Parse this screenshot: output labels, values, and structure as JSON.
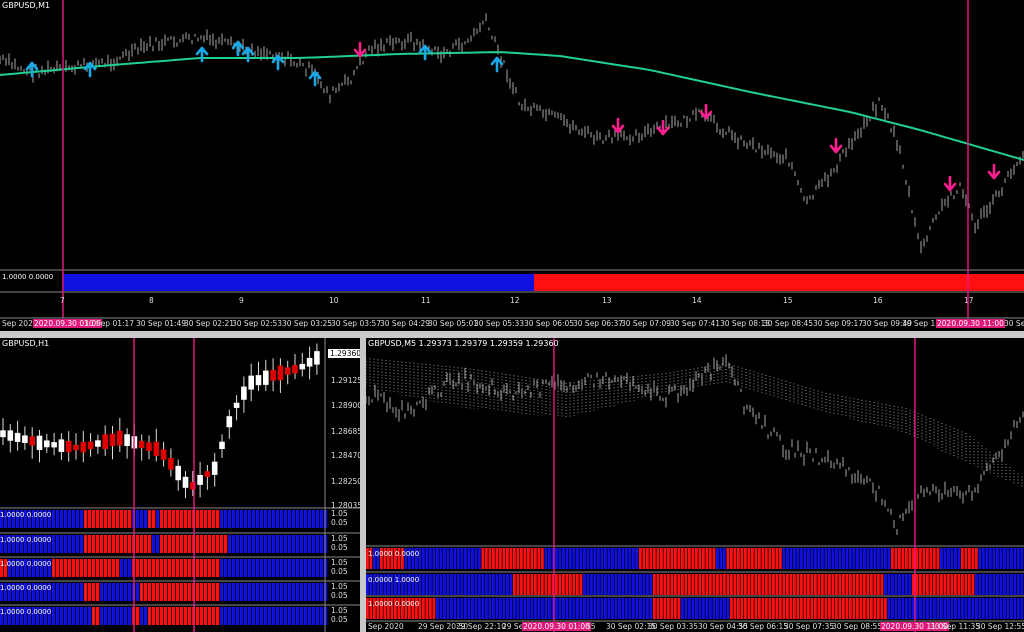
{
  "top": {
    "title": "GBPUSD,M1",
    "indicator_label": "1.0000 0.0000",
    "hour_labels": [
      "7",
      "8",
      "9",
      "10",
      "11",
      "12",
      "13",
      "14",
      "15",
      "16",
      "17"
    ],
    "time_labels": [
      "Sep 2020",
      "2020.09.30 01:00",
      "30 Sep 01:17",
      "30 Sep 01:49",
      "30 Sep 02:21",
      "30 Sep 02:53",
      "30 Sep 03:25",
      "30 Sep 03:57",
      "30 Sep 04:29",
      "30 Sep 05:01",
      "30 Sep 05:33",
      "30 Sep 06:05",
      "30 Sep 06:37",
      "30 Sep 07:09",
      "30 Sep 07:41",
      "30 Sep 08:13",
      "30 Sep 08:45",
      "30 Sep 09:17",
      "30 Sep 09:49",
      "30 Sep 1",
      "2020.09.30 11:00",
      "30 Sep"
    ]
  },
  "left": {
    "title": "GBPUSD,H1",
    "current_price": "1.29360",
    "price_labels": [
      "1.29125",
      "1.28900",
      "1.28685",
      "1.28470",
      "1.28250",
      "1.28035"
    ],
    "ind_labels": [
      "1.0000 0.0000",
      "1.0000 0.0000",
      "1.0000 0.0000",
      "1.0000 0.0000",
      "1.0000 0.0000"
    ],
    "ind_scale": [
      "1.05",
      "0.05"
    ]
  },
  "right": {
    "title": "GBPUSD,M5  1.29373 1.29379 1.29359 1.29360",
    "ind_labels": [
      "1.0000 0.0000",
      "0.0000 1.0000",
      "1.0000 0.0000"
    ],
    "time_labels": [
      "Sep 2020",
      "29 Sep 20:50",
      "29 Sep 22:10",
      "29 Se",
      "2020.09.30 01:00",
      "55",
      "30 Sep 02:15",
      "30 Sep 03:35",
      "30 Sep 04:55",
      "30 Sep 06:15",
      "30 Sep 07:35",
      "30 Sep 08:55",
      "2020.09.30 11:00",
      "30 Sep 11:35",
      "30 Sep 12:55"
    ]
  },
  "colors": {
    "bull": "#1010e0",
    "bear": "#ff1010",
    "ma": "#20d090",
    "vline": "#e0197a",
    "up_arrow": "#18a8e8",
    "down_arrow": "#ff1f8f"
  }
}
